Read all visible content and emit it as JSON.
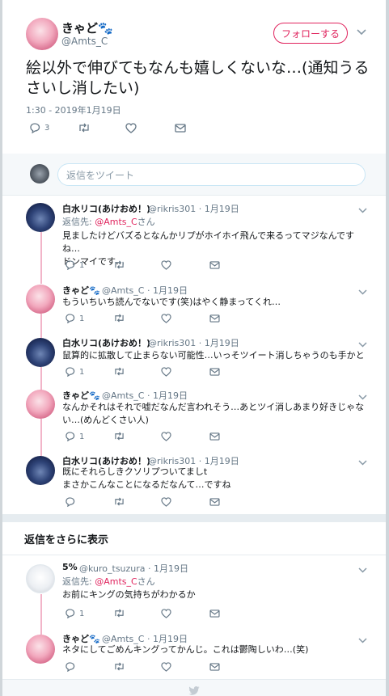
{
  "main_tweet": {
    "name": "きゃど🐾",
    "handle": "@Amts_C",
    "follow_label": "フォローする",
    "text": "絵以外で伸びてもなんも嬉しくないな…(通知うるさいし消したい)",
    "timestamp": "1:30 - 2019年1月19日",
    "reply_count": "3",
    "icons": [
      "reply-icon",
      "retweet-icon",
      "like-icon",
      "dm-icon",
      "chevron-down-icon"
    ]
  },
  "reply_box": {
    "placeholder": "返信をツイート"
  },
  "replies": [
    {
      "name": "白水リコ(あけおめ！)",
      "handle": "@rikris301 · 1月19日",
      "reply_to_prefix": "返信先: ",
      "reply_to_user": "@Amts_C",
      "reply_to_suffix": "さん",
      "text_line1": "見ましたけどバズるとなんかリプがホイホイ飛んで来るってマジなんですね…",
      "text_line2": "ドンマイです…",
      "reply_count": "1"
    },
    {
      "name": "きゃど🐾",
      "handle": "@Amts_C · 1月19日",
      "text_line1": "もういちいち読んでないです(笑)はやく静まってくれ…",
      "reply_count": "1"
    },
    {
      "name": "白水リコ(あけおめ！)",
      "handle": "@rikris301 · 1月19日",
      "text_line1": "鼠算的に拡散して止まらない可能性…いっそツイート消しちゃうのも手かと",
      "reply_count": "1"
    },
    {
      "name": "きゃど🐾",
      "handle": "@Amts_C · 1月19日",
      "text_line1": "なんかそれはそれで嘘だなんだ言われそう…あとツイ消しあまり好きじゃな",
      "text_line2": "い…(めんどくさい人)",
      "reply_count": "1"
    },
    {
      "name": "白水リコ(あけおめ！)",
      "handle": "@rikris301 · 1月19日",
      "text_line1": "既にそれらしきクソリプついてましt",
      "text_line2": "まさかこんなことになるだなんて…ですね"
    }
  ],
  "show_more": {
    "label": "返信をさらに表示"
  },
  "replies2": [
    {
      "name": "5%",
      "handle": "@kuro_tsuzura · 1月19日",
      "reply_to_prefix": "返信先: ",
      "reply_to_user": "@Amts_C",
      "reply_to_suffix": "さん",
      "text_line1": "お前にキングの気持ちがわかるか",
      "reply_count": "1"
    },
    {
      "name": "きゃど🐾",
      "handle": "@Amts_C · 1月19日",
      "text_line1": "ネタにしてごめんキングってかんじ。これは鬱陶しいわ…(笑)"
    }
  ],
  "colors": {
    "accent": "#e0245e",
    "thread_line": "#f2b5c9",
    "muted": "#657786",
    "background": "#e6ecf0"
  }
}
